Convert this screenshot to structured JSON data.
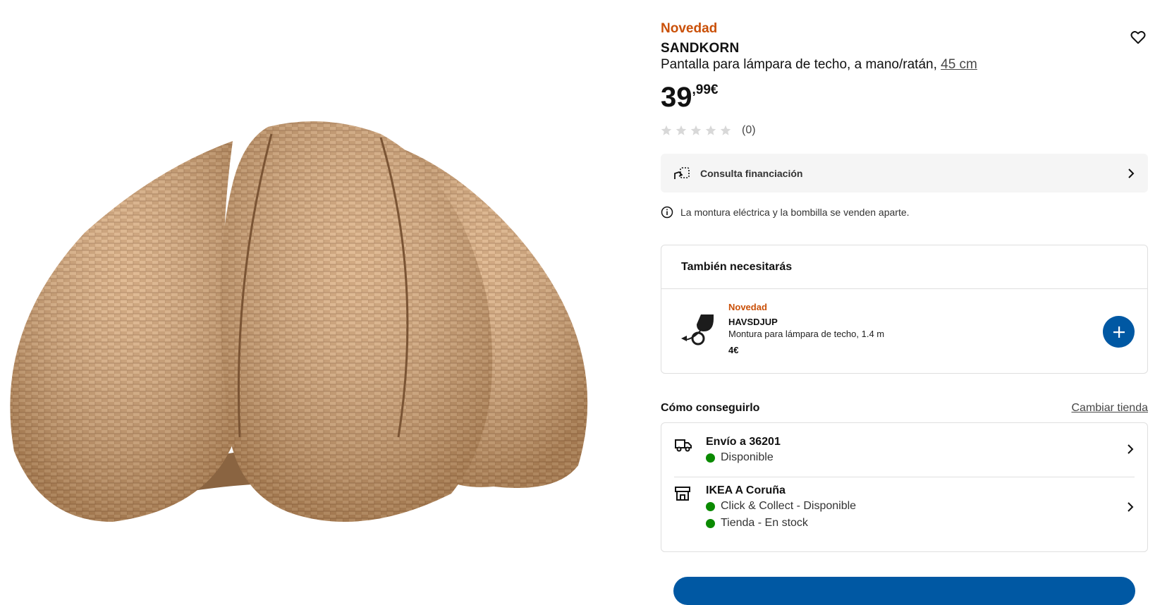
{
  "product": {
    "badge": "Novedad",
    "name": "SANDKORN",
    "description": "Pantalla para lámpara de techo, a mano/ratán,",
    "measure": "45 cm",
    "price_int": "39",
    "price_dec": ",99€",
    "rating_count": "(0)",
    "rating_stars": 0,
    "image": "rattan-lampshade-image"
  },
  "finance": {
    "label": "Consulta financiación",
    "icon": "financing-icon"
  },
  "notice": {
    "text": "La montura eléctrica y la bombilla se venden aparte.",
    "icon": "info-icon"
  },
  "also_need": {
    "title": "También necesitarás",
    "item": {
      "badge": "Novedad",
      "name": "HAVSDJUP",
      "description": "Montura para lámpara de techo, 1.4 m",
      "price": "4€"
    }
  },
  "how_to_get": {
    "title": "Cómo conseguirlo",
    "change_store": "Cambiar tienda",
    "delivery": {
      "title": "Envío a 36201",
      "status": "Disponible"
    },
    "store": {
      "title": "IKEA A Coruña",
      "status1": "Click & Collect - Disponible",
      "status2": "Tienda - En stock"
    }
  },
  "colors": {
    "accent_new": "#ca5008",
    "primary_blue": "#0058a3",
    "available_green": "#0a8a00"
  }
}
